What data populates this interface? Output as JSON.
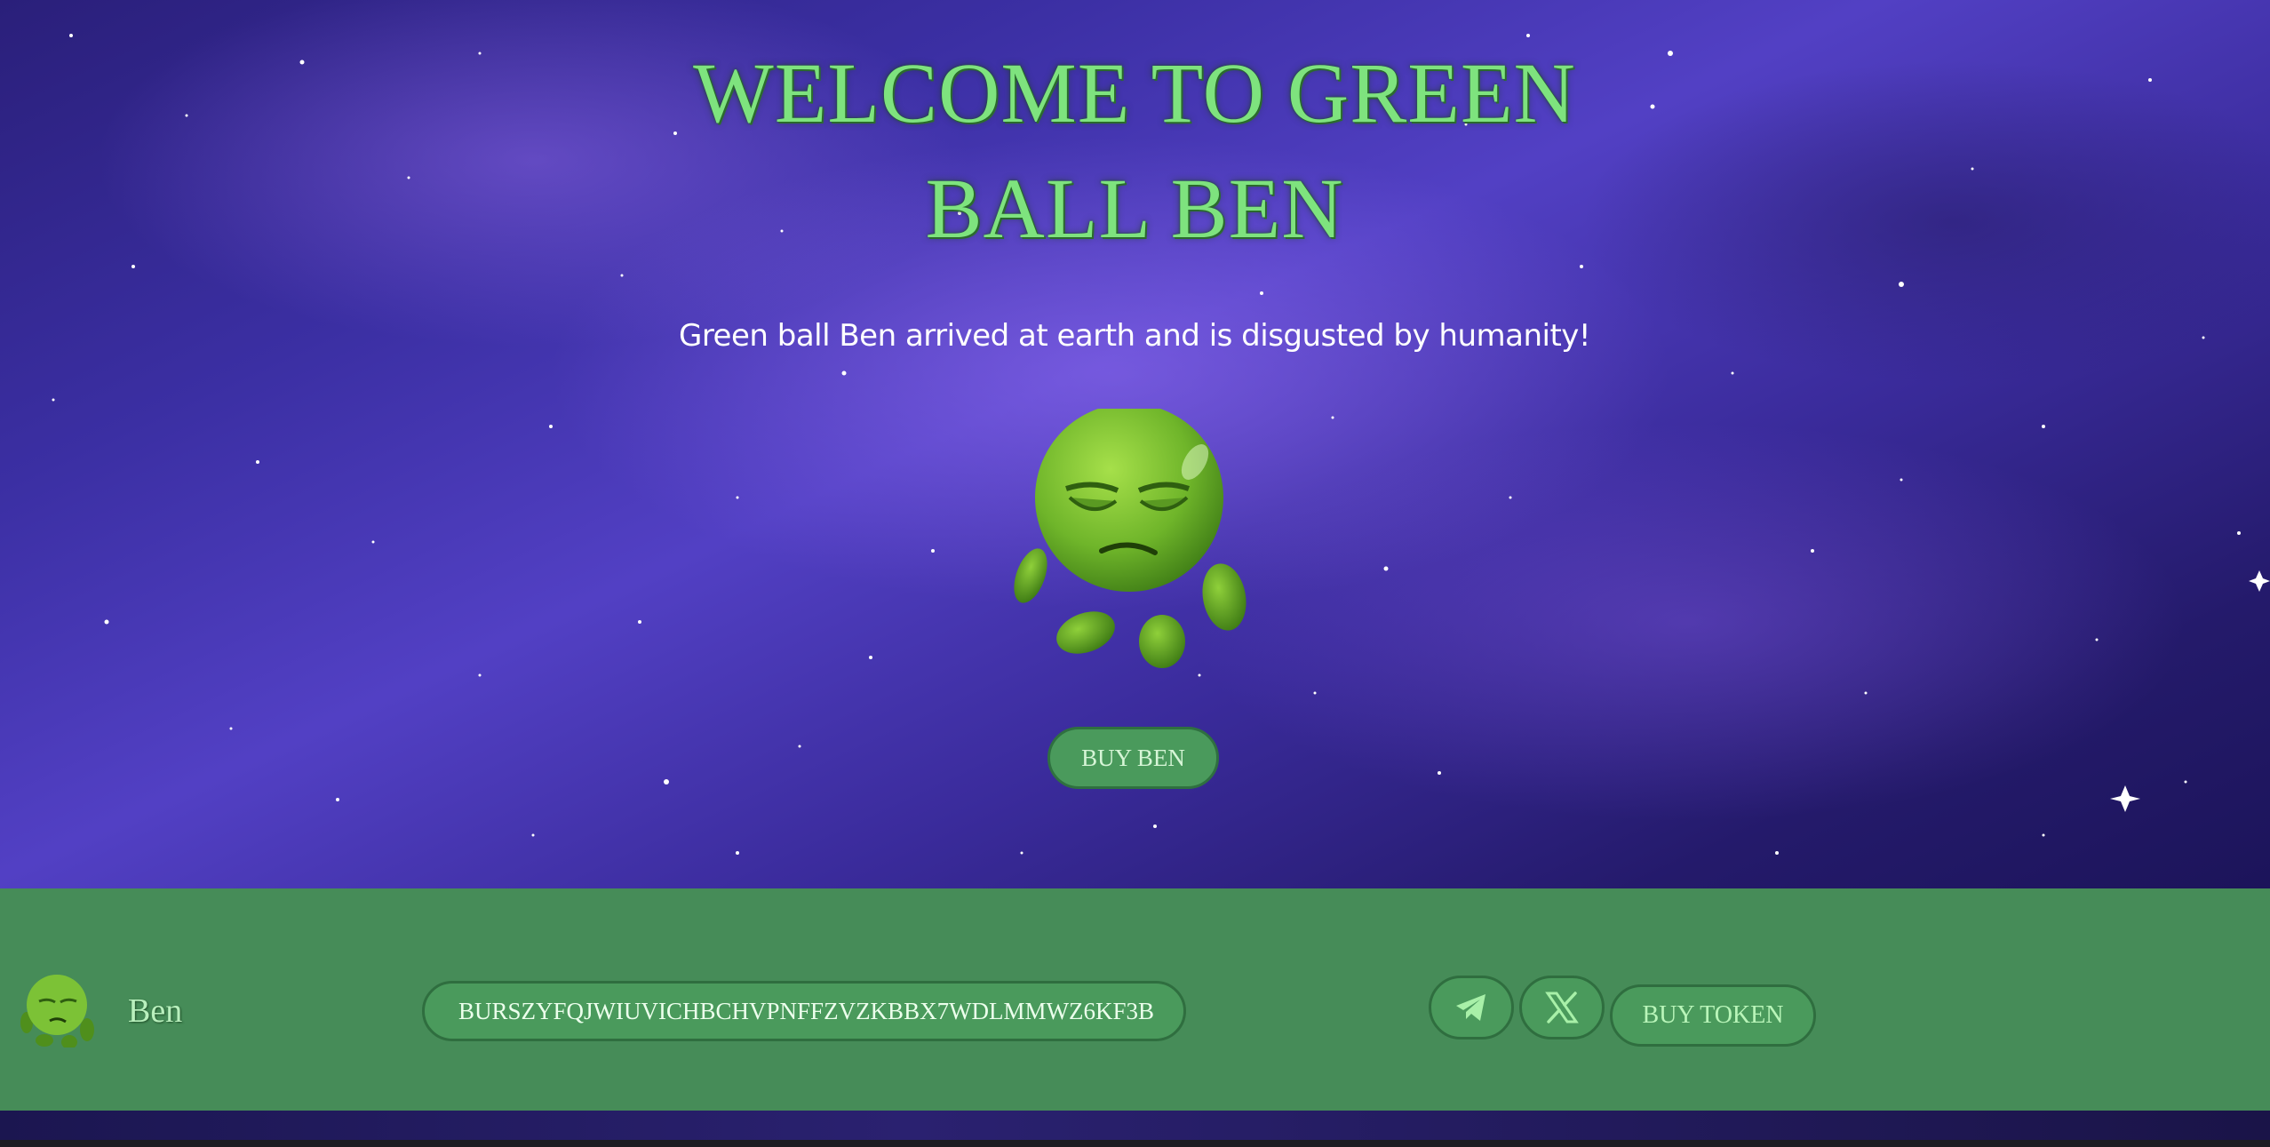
{
  "hero": {
    "title_line1": "WELCOME TO GREEN",
    "title_line2": "BALL BEN",
    "subtitle": "Green ball Ben arrived at earth and is disgusted by humanity!",
    "buy_button": "BUY BEN"
  },
  "footer": {
    "brand_name": "Ben",
    "contract_address": "BURSZYFQJWIUVICHBCHVPNFFZVZKBBX7WDLMMWZ6KF3B",
    "buy_token_label": "BUY TOKEN",
    "social_icons": [
      "telegram-icon",
      "x-icon"
    ]
  },
  "colors": {
    "accent_green": "#7ee37e",
    "footer_bg": "#468c58",
    "button_bg": "#4a9a5c"
  }
}
